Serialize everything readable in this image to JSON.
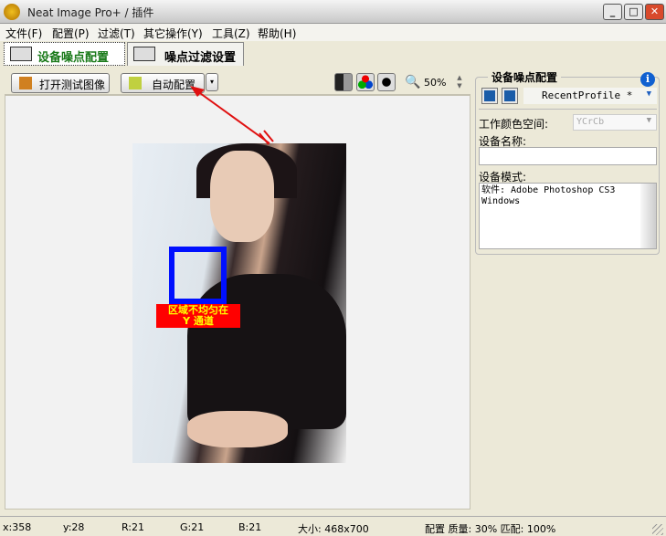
{
  "window": {
    "title": "Neat Image Pro+ / 插件",
    "min": "_",
    "max": "□",
    "close": "✕"
  },
  "menu": [
    "文件(F)",
    "配置(P)",
    "过滤(T)",
    "其它操作(Y)",
    "工具(Z)",
    "帮助(H)"
  ],
  "tabs": [
    {
      "label": "设备噪点配置",
      "active": true
    },
    {
      "label": "噪点过滤设置",
      "active": false
    }
  ],
  "toolbar": {
    "open_test_image": "打开测试图像",
    "auto_profile": "自动配置",
    "zoom": "50%"
  },
  "overlay": {
    "warning_line1": "区域不均匀在",
    "warning_line2": "Y 通道"
  },
  "panel": {
    "title": "设备噪点配置",
    "info": "i",
    "profile": "RecentProfile *",
    "color_space_label": "工作颜色空间:",
    "color_space_value": "YCrCb",
    "device_name_label": "设备名称:",
    "device_name_value": "",
    "device_mode_label": "设备模式:",
    "device_mode_value": "软件: Adobe Photoshop CS3\nWindows"
  },
  "status": {
    "x": "x:358",
    "y": "y:28",
    "r": "R:21",
    "g": "G:21",
    "b": "B:21",
    "size": "大小: 468x700",
    "quality": "配置 质量: 30% 匹配: 100%"
  },
  "colors": {
    "accent_green": "#1a7a1a",
    "arrow": "#e01010",
    "roi": "#0010ff"
  }
}
